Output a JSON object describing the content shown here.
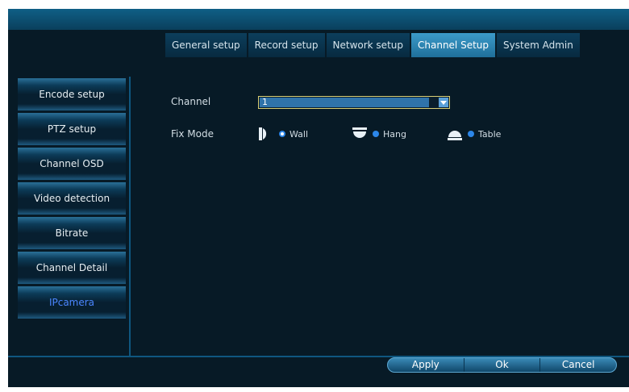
{
  "tabs": [
    "General setup",
    "Record setup",
    "Network setup",
    "Channel Setup",
    "System Admin"
  ],
  "active_tab": "Channel Setup",
  "sidebar": {
    "items": [
      "Encode setup",
      "PTZ setup",
      "Channel OSD",
      "Video detection",
      "Bitrate",
      "Channel Detail",
      "IPcamera"
    ],
    "active": "IPcamera"
  },
  "form": {
    "channel_label": "Channel",
    "channel_value": "1",
    "fixmode_label": "Fix Mode",
    "modes": [
      "Wall",
      "Hang",
      "Table"
    ],
    "selected_mode": "Wall"
  },
  "buttons": {
    "apply": "Apply",
    "ok": "Ok",
    "cancel": "Cancel"
  },
  "colors": {
    "background": "#071a26",
    "accent": "#2f73aa",
    "active_tab": "#3c9bca",
    "active_sidebar_text": "#4b86ff"
  }
}
